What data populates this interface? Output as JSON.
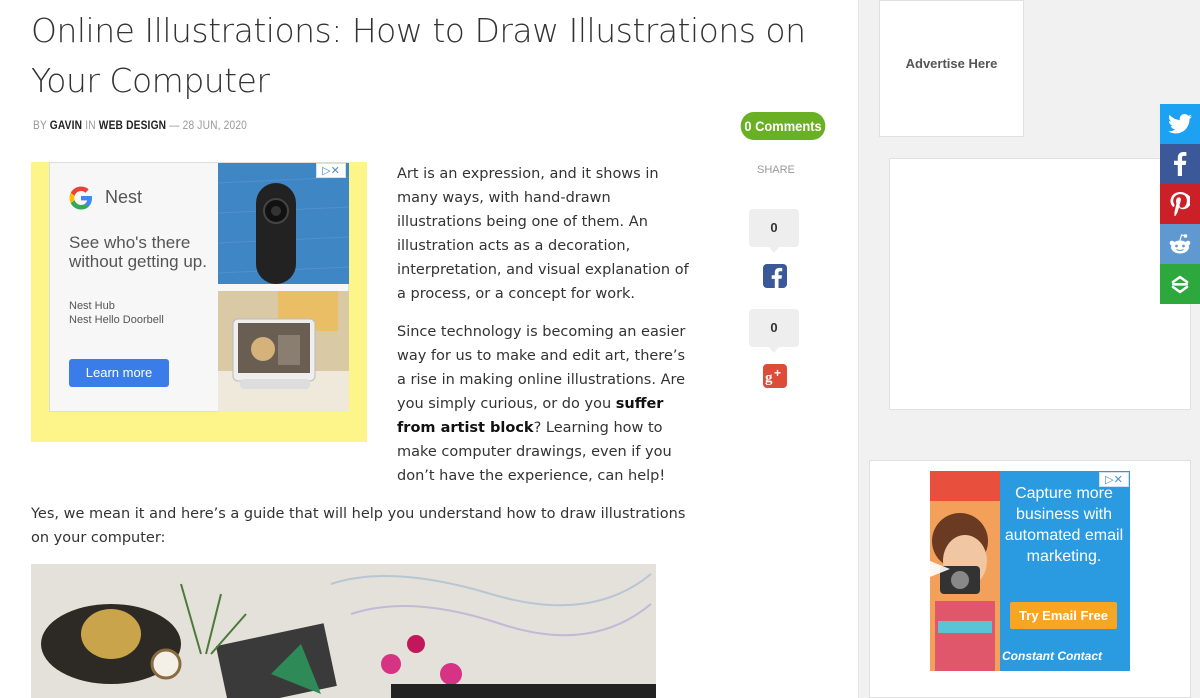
{
  "article": {
    "title": "Online Illustrations: How to Draw Illustrations on Your Computer",
    "byline": {
      "by": "BY",
      "author": "GAVIN",
      "in": "IN",
      "category": "WEB DESIGN",
      "dash": "—",
      "date": "28 JUN, 2020"
    },
    "comments_label": "0 Comments",
    "paragraph1": "Art is an expression, and it shows in many ways, with hand-drawn illustrations being one of them. An illustration acts as a decoration, interpretation, and visual explanation of a process, or a concept for work.",
    "paragraph2_before": "Since technology is becoming an easier way for us to make and edit art, there’s a rise in making online illustrations. Are you simply curious, or do you ",
    "paragraph2_bold": "suffer from artist block",
    "paragraph2_after": "? Learning how to make computer drawings, even if you don’t have the experience, can help!",
    "paragraph3": "Yes, we mean it and here’s a guide that will help you understand how to draw illustrations on your computer:"
  },
  "inline_ad": {
    "brand": "Nest",
    "headline": "See who's there without getting up.",
    "sub1": "Nest Hub",
    "sub2": "Nest Hello Doorbell",
    "cta": "Learn more",
    "adchoices": "▷✕"
  },
  "share": {
    "label": "SHARE",
    "facebook_count": "0",
    "google_count": "0",
    "facebook_icon": "facebook-icon",
    "google_icon": "google-plus-icon"
  },
  "sidebar": {
    "advertise_label": "Advertise Here",
    "cc_ad": {
      "text": "Capture more business with automated email marketing.",
      "cta": "Try Email Free",
      "logo": "Constant Contact",
      "adchoices": "▷✕"
    }
  },
  "social_bar": {
    "buttons": [
      {
        "name": "twitter",
        "color": "#1da1f2"
      },
      {
        "name": "facebook",
        "color": "#3b5998"
      },
      {
        "name": "pinterest",
        "color": "#cb2027"
      },
      {
        "name": "reddit",
        "color": "#5f99cf"
      },
      {
        "name": "more",
        "color": "#2ca83d"
      }
    ]
  },
  "colors": {
    "comments_badge": "#6ab024",
    "ad_background": "#fdf48a",
    "learn_more": "#3b7de8"
  }
}
